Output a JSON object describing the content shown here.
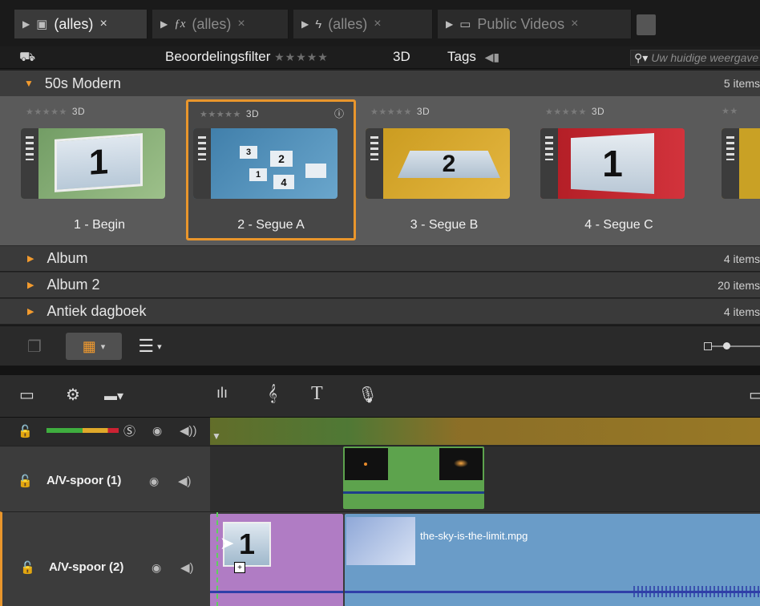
{
  "tabs": [
    {
      "label": "(alles)",
      "icon": "media-icon",
      "close": "×",
      "active": true
    },
    {
      "label": "(alles)",
      "icon": "fx-icon",
      "close": "×",
      "active": false
    },
    {
      "label": "(alles)",
      "icon": "lightning-icon",
      "close": "×",
      "active": false
    },
    {
      "label": "Public Videos",
      "icon": "video-folder-icon",
      "close": "×",
      "active": false
    }
  ],
  "filterbar": {
    "rating_label": "Beoordelingsfilter",
    "stars": "★★★★★",
    "threed_label": "3D",
    "tags_label": "Tags",
    "search_placeholder": "Uw huidige weergave doorzoeken"
  },
  "open_category": {
    "name": "50s Modern",
    "count": "5 items"
  },
  "thumbnails": [
    {
      "title": "1 - Begin",
      "stars": "★★★★★",
      "badge": "3D",
      "selected": false
    },
    {
      "title": "2 - Segue A",
      "stars": "★★★★★",
      "badge": "3D",
      "selected": true
    },
    {
      "title": "3 - Segue B",
      "stars": "★★★★★",
      "badge": "3D",
      "selected": false
    },
    {
      "title": "4 - Segue C",
      "stars": "★★★★★",
      "badge": "3D",
      "selected": false
    }
  ],
  "categories": [
    {
      "name": "Album",
      "count": "4 items"
    },
    {
      "name": "Album 2",
      "count": "20 items"
    },
    {
      "name": "Antiek dagboek",
      "count": "4 items"
    }
  ],
  "tracks": [
    {
      "name": "A/V-spoor (1)"
    },
    {
      "name": "A/V-spoor (2)",
      "clip_label": "the-sky-is-the-limit.mpg"
    }
  ],
  "colors": {
    "accent": "#e9962c",
    "track_blue": "#5c8fbf",
    "track_green": "#57a04a",
    "transition_purple": "#b07cc4"
  }
}
